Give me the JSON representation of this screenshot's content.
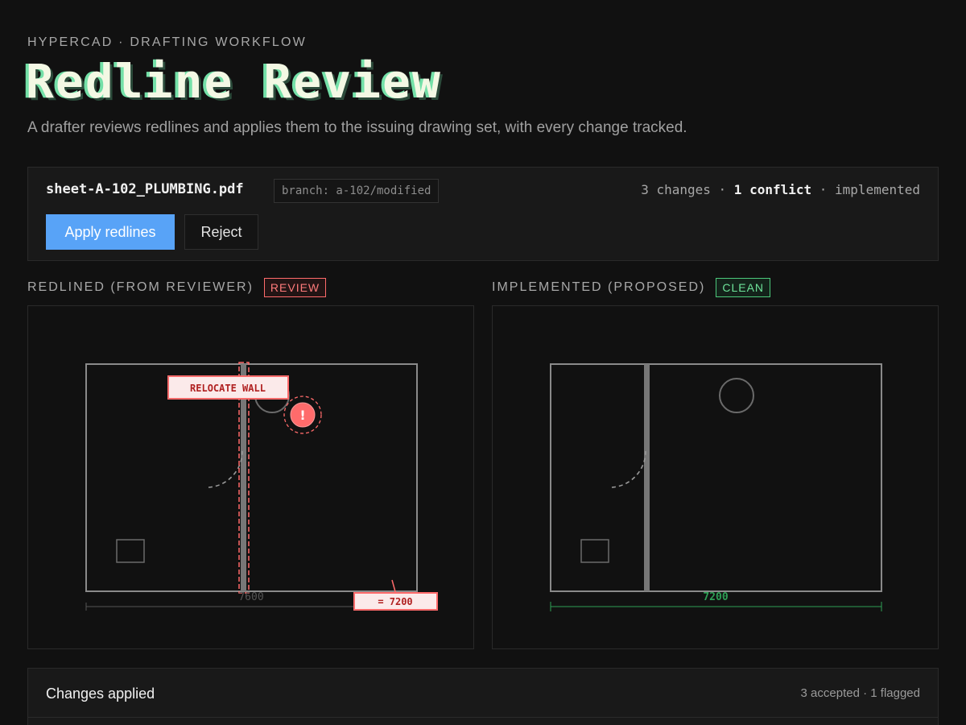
{
  "header": {
    "eyebrow": "HYPERCAD · DRAFTING WORKFLOW",
    "title": "Redline Review",
    "subtitle": "A drafter reviews redlines and applies them to the issuing drawing set, with every change tracked."
  },
  "file": {
    "name": "sheet-A-102_PLUMBING.pdf",
    "branch": "branch: a-102/modified",
    "summary_changes": "3 changes",
    "summary_sep": " · ",
    "summary_conflict": "1 conflict",
    "summary_status": "implemented"
  },
  "actions": {
    "apply_label": "Apply redlines",
    "reject_label": "Reject"
  },
  "panels": {
    "redlined": {
      "label": "REDLINED (FROM REVIEWER)",
      "tag": "REVIEW",
      "callout": "RELOCATE WALL",
      "warning_glyph": "!",
      "old_dimension": "7600",
      "new_dimension": "= 7200"
    },
    "implemented": {
      "label": "IMPLEMENTED (PROPOSED)",
      "tag": "CLEAN",
      "dimension": "7200"
    }
  },
  "changes": {
    "title": "Changes applied",
    "count": "3 accepted · 1 flagged"
  },
  "colors": {
    "accent": "#58a3f7",
    "redline": "#ff6b6b",
    "clean": "#4cc97b",
    "title": "#f3f8e4",
    "title_shadow": "#74e0a8"
  }
}
